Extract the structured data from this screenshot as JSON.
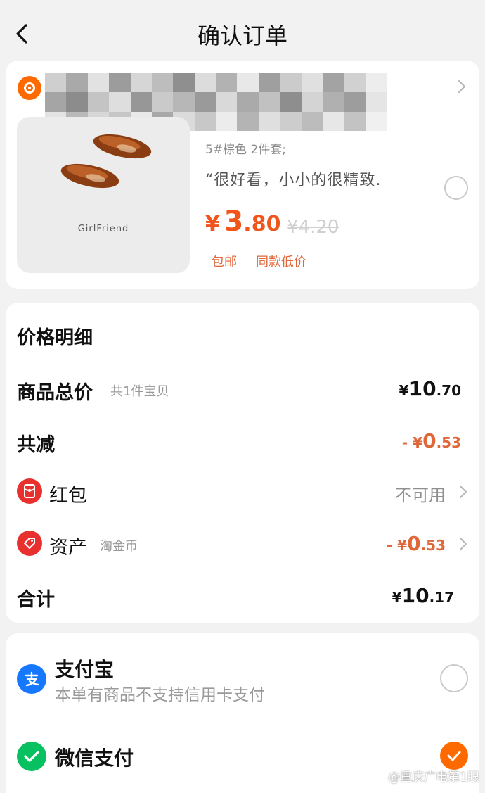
{
  "header": {
    "title": "确认订单",
    "back_icon": "chevron-left-icon"
  },
  "address": {
    "pin_icon": "location-pin-icon",
    "chevron_icon": "chevron-right-icon"
  },
  "product": {
    "image_brand": "GirlFriend",
    "sku": "5#棕色 2件套;",
    "review": "“很好看，小小的很精致.",
    "price_currency": "¥",
    "price_int": "3",
    "price_dec": ".80",
    "price_original": "¥4.20",
    "tags": [
      "包邮",
      "同款低价"
    ]
  },
  "price_detail": {
    "title": "价格明细",
    "total": {
      "label": "商品总价",
      "sub": "共1件宝贝",
      "currency": "¥",
      "int": "10",
      "dec": ".70"
    },
    "discount": {
      "label": "共减",
      "currency": "- ¥",
      "int": "0",
      "dec": ".53"
    },
    "red_packet": {
      "label": "红包",
      "value": "不可用",
      "icon": "red-packet-icon"
    },
    "assets": {
      "label": "资产",
      "sub": "淘金币",
      "currency": "- ¥",
      "int": "0",
      "dec": ".53",
      "icon": "coin-tag-icon"
    },
    "sum": {
      "label": "合计",
      "currency": "¥",
      "int": "10",
      "dec": ".17"
    }
  },
  "payment": {
    "alipay": {
      "name": "支付宝",
      "note": "本单有商品不支持信用卡支付",
      "icon": "alipay-icon",
      "selected": false
    },
    "wechat": {
      "name": "微信支付",
      "icon": "wechat-pay-icon",
      "selected": true
    }
  },
  "watermark": "@重庆广电第1眼",
  "colors": {
    "accent": "#ff6a00",
    "price": "#f0551c",
    "alipay": "#1677ff",
    "wechat": "#07c160",
    "red": "#e8302f"
  }
}
